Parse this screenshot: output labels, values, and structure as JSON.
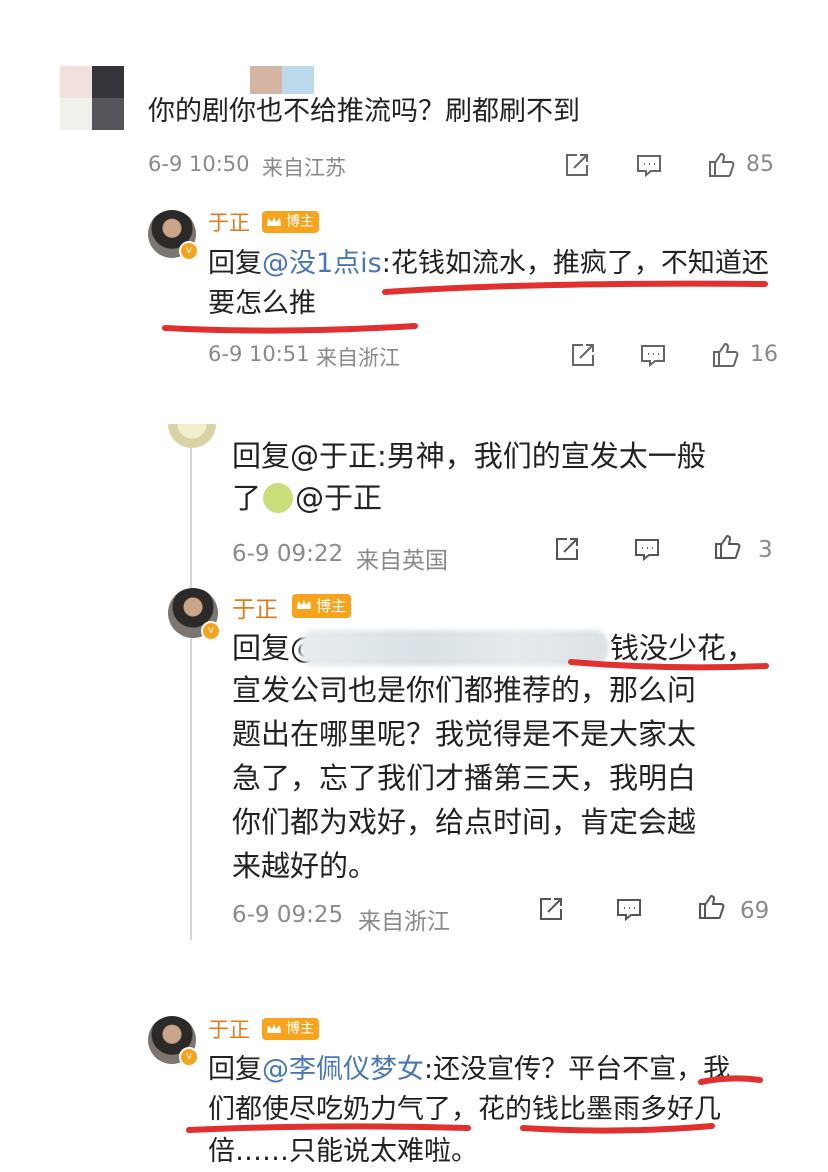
{
  "comment1": {
    "text": "你的剧你也不给推流吗？刷都刷不到",
    "time": "6-9 10:50",
    "location": "来自江苏",
    "likes": "85"
  },
  "reply1": {
    "author": "于正",
    "badge": "博主",
    "prefix": "回复",
    "mention": "@没1点is",
    "text_line1_tail": ":花钱如流水，推疯了，不知道还",
    "text_line2": "要怎么推",
    "time": "6-9 10:51",
    "location": "来自浙江",
    "likes": "16"
  },
  "comment2": {
    "line1": "回复@于正:男神，我们的宣发太一般",
    "line2_pre": "了",
    "line2_post": "@于正",
    "time": "6-9 09:22",
    "location": "来自英国",
    "likes": "3"
  },
  "reply2": {
    "author": "于正",
    "badge": "博主",
    "prefix": "回复@",
    "line1_tail": "钱没少花，",
    "line2": "宣发公司也是你们都推荐的，那么问",
    "line3": "题出在哪里呢？我觉得是不是大家太",
    "line4": "急了，忘了我们才播第三天，我明白",
    "line5": "你们都为戏好，给点时间，肯定会越",
    "line6": "来越好的。",
    "time": "6-9 09:25",
    "location": "来自浙江",
    "likes": "69"
  },
  "reply3": {
    "author": "于正",
    "badge": "博主",
    "prefix": "回复",
    "mention": "@李佩仪梦女",
    "line1_tail": ":还没宣传？平台不宣，我",
    "line2": "们都使尽吃奶力气了，花的钱比墨雨多好几",
    "line3": "倍……只能说太难啦。"
  },
  "colors": {
    "underline": "#e0312f",
    "mention": "#4a77b4",
    "name": "#e07b1c",
    "meta": "#8a8a8a"
  },
  "icons": [
    "share-icon",
    "comment-icon",
    "like-icon"
  ]
}
